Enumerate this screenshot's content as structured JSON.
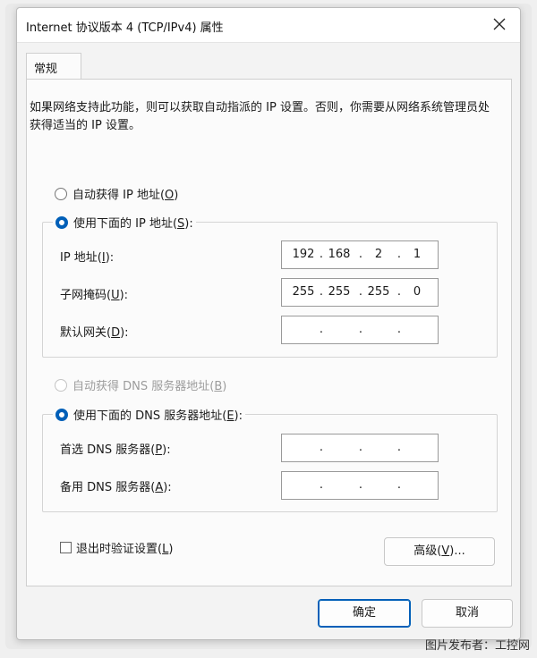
{
  "window": {
    "title": "Internet 协议版本 4 (TCP/IPv4) 属性"
  },
  "tabs": [
    {
      "label": "常规"
    }
  ],
  "description": "如果网络支持此功能，则可以获取自动指派的 IP 设置。否则，你需要从网络系统管理员处获得适当的 IP 设置。",
  "ip_section": {
    "auto_label": "自动获得 IP 地址(",
    "auto_key": "O",
    "manual_label": "使用下面的 IP 地址(",
    "manual_key": "S",
    "selected": "manual",
    "fields": [
      {
        "label": "IP 地址(",
        "key": "I",
        "octets": [
          "192",
          "168",
          "2",
          "1"
        ]
      },
      {
        "label": "子网掩码(",
        "key": "U",
        "octets": [
          "255",
          "255",
          "255",
          "0"
        ]
      },
      {
        "label": "默认网关(",
        "key": "D",
        "octets": [
          "",
          "",
          "",
          ""
        ]
      }
    ]
  },
  "dns_section": {
    "auto_label": "自动获得 DNS 服务器地址(",
    "auto_key": "B",
    "manual_label": "使用下面的 DNS 服务器地址(",
    "manual_key": "E",
    "selected": "manual",
    "fields": [
      {
        "label": "首选 DNS 服务器(",
        "key": "P",
        "octets": [
          "",
          "",
          "",
          ""
        ]
      },
      {
        "label": "备用 DNS 服务器(",
        "key": "A",
        "octets": [
          "",
          "",
          "",
          ""
        ]
      }
    ]
  },
  "validate_checkbox": {
    "label": "退出时验证设置(",
    "key": "L",
    "checked": false
  },
  "buttons": {
    "advanced": "高级(",
    "advanced_key": "V",
    "advanced_suffix": ")...",
    "ok": "确定",
    "cancel": "取消"
  },
  "watermark": "图片发布者：工控网",
  "colors": {
    "accent": "#005fb8",
    "disabled": "#9c9c9c"
  }
}
